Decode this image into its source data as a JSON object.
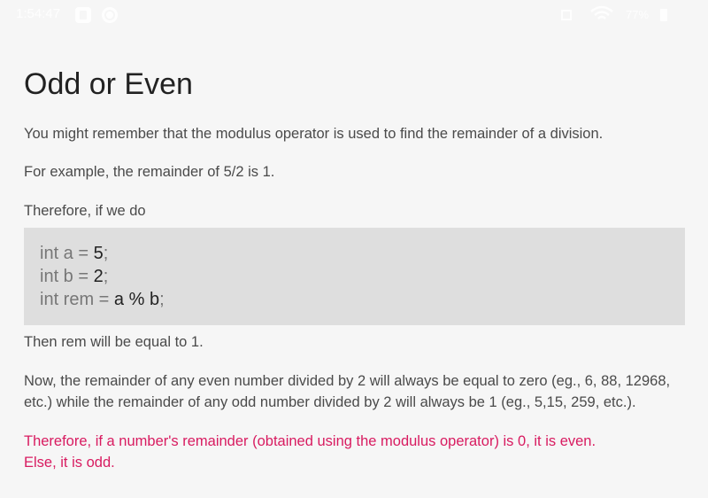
{
  "status_bar": {
    "time": "1:54:47",
    "battery": "77%",
    "icons": [
      "notification-icon",
      "sync-icon",
      "signal-icon",
      "wifi-icon",
      "battery-icon"
    ]
  },
  "page": {
    "title": "Odd or Even",
    "p1": "You might remember that the modulus operator is used to find the remainder of a division.",
    "p2": "For example, the remainder of 5/2 is 1.",
    "p3": "Therefore, if we do",
    "code": [
      {
        "prefix": "int a = ",
        "value": "5",
        "suffix": ";"
      },
      {
        "prefix": "int b = ",
        "value": "2",
        "suffix": ";"
      },
      {
        "prefix": "int rem = ",
        "value": "a % b",
        "suffix": ";"
      }
    ],
    "p4": "Then rem will be equal to 1.",
    "p5": "Now, the remainder of any even number divided by 2 will always be equal to zero (eg., 6, 88, 12968, etc.) while the remainder of any odd number divided by 2 will always be 1 (eg., 5,15, 259, etc.).",
    "highlight_1": "Therefore, if a number's remainder (obtained using the modulus operator) is 0, it is even.",
    "highlight_2": "Else, it is odd."
  },
  "colors": {
    "highlight": "#d81b60",
    "code_background": "#dedede",
    "page_background": "#f6f6f6"
  }
}
